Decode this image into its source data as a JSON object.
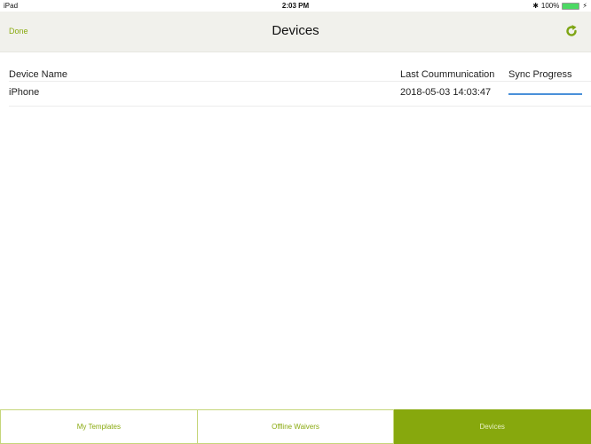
{
  "status_bar": {
    "device": "iPad",
    "time": "2:03 PM",
    "bluetooth_icon": "bluetooth-icon",
    "battery_percent": "100%",
    "battery_level": 1.0,
    "charging_icon": "bolt-icon"
  },
  "navbar": {
    "done_label": "Done",
    "title": "Devices",
    "refresh_icon": "refresh-icon"
  },
  "colors": {
    "accent": "#87a80d",
    "progress": "#4a90d9",
    "navbar_bg": "#f1f1ec"
  },
  "table": {
    "columns": [
      "Device Name",
      "Last Coummunication",
      "Sync Progress"
    ],
    "rows": [
      {
        "device_name": "iPhone",
        "last_communication": "2018-05-03 14:03:47",
        "sync_progress": 1.0
      }
    ]
  },
  "tabbar": {
    "tabs": [
      {
        "label": "My Templates",
        "active": false
      },
      {
        "label": "Offline Waivers",
        "active": false
      },
      {
        "label": "Devices",
        "active": true
      }
    ]
  }
}
